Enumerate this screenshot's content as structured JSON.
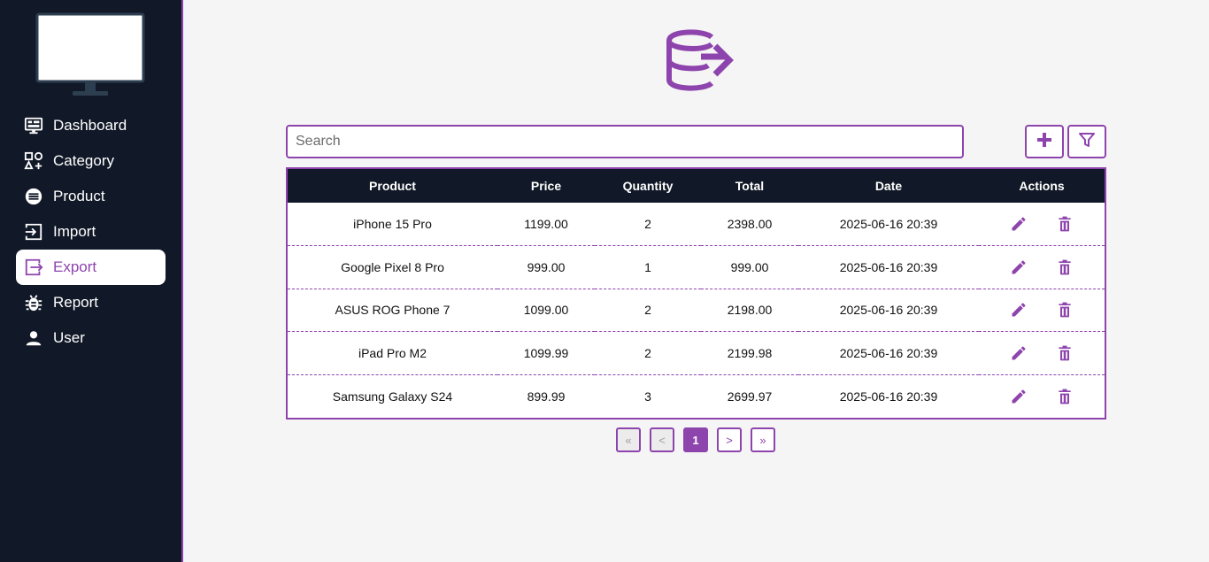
{
  "sidebar": {
    "items": [
      {
        "label": "Dashboard",
        "icon": "dashboard-icon"
      },
      {
        "label": "Category",
        "icon": "category-icon"
      },
      {
        "label": "Product",
        "icon": "product-icon"
      },
      {
        "label": "Import",
        "icon": "import-icon"
      },
      {
        "label": "Export",
        "icon": "export-icon",
        "active": true
      },
      {
        "label": "Report",
        "icon": "bug-icon"
      },
      {
        "label": "User",
        "icon": "user-icon"
      }
    ]
  },
  "search": {
    "placeholder": "Search",
    "value": ""
  },
  "table": {
    "headers": [
      "Product",
      "Price",
      "Quantity",
      "Total",
      "Date",
      "Actions"
    ],
    "rows": [
      {
        "product": "iPhone 15 Pro",
        "price": "1199.00",
        "quantity": "2",
        "total": "2398.00",
        "date": "2025-06-16 20:39"
      },
      {
        "product": "Google Pixel 8 Pro",
        "price": "999.00",
        "quantity": "1",
        "total": "999.00",
        "date": "2025-06-16 20:39"
      },
      {
        "product": "ASUS ROG Phone 7",
        "price": "1099.00",
        "quantity": "2",
        "total": "2198.00",
        "date": "2025-06-16 20:39"
      },
      {
        "product": "iPad Pro M2",
        "price": "1099.99",
        "quantity": "2",
        "total": "2199.98",
        "date": "2025-06-16 20:39"
      },
      {
        "product": "Samsung Galaxy S24",
        "price": "899.99",
        "quantity": "3",
        "total": "2699.97",
        "date": "2025-06-16 20:39"
      }
    ]
  },
  "pagination": {
    "first": "«",
    "prev": "<",
    "current": "1",
    "next": ">",
    "last": "»"
  },
  "colors": {
    "accent": "#8e44ad",
    "sidebar": "#111827",
    "background": "#f5f5f5"
  }
}
